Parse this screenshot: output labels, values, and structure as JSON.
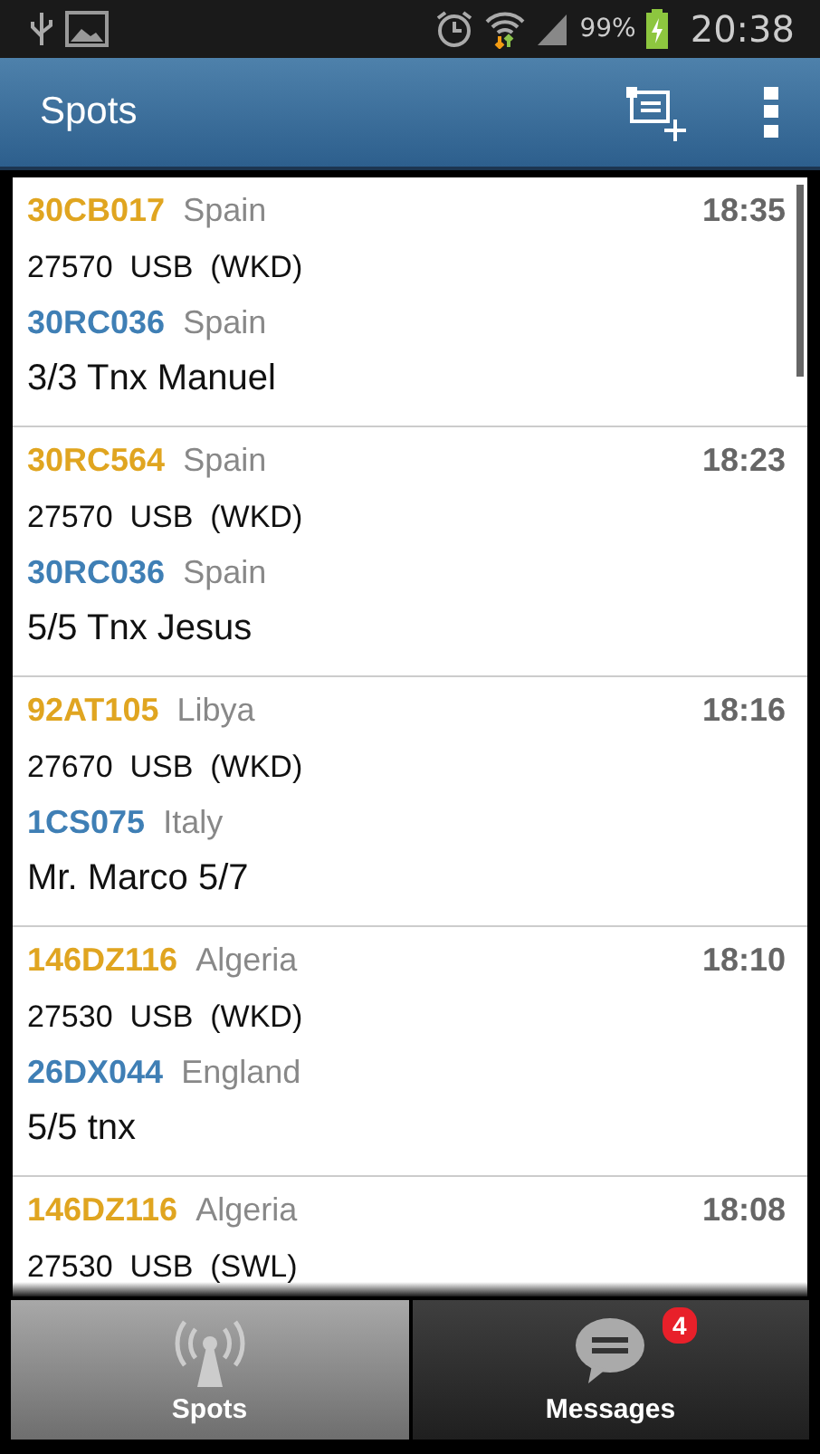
{
  "status_bar": {
    "battery": "99%",
    "time": "20:38"
  },
  "action_bar": {
    "title": "Spots"
  },
  "spots": [
    {
      "callsign": "30CB017",
      "country": "Spain",
      "time": "18:35",
      "frequency": "27570",
      "mode": "USB",
      "tag": "(WKD)",
      "spotter": "30RC036",
      "spotter_country": "Spain",
      "message": "3/3 Tnx Manuel"
    },
    {
      "callsign": "30RC564",
      "country": "Spain",
      "time": "18:23",
      "frequency": "27570",
      "mode": "USB",
      "tag": "(WKD)",
      "spotter": "30RC036",
      "spotter_country": "Spain",
      "message": "5/5 Tnx Jesus"
    },
    {
      "callsign": "92AT105",
      "country": "Libya",
      "time": "18:16",
      "frequency": "27670",
      "mode": "USB",
      "tag": "(WKD)",
      "spotter": "1CS075",
      "spotter_country": "Italy",
      "message": "Mr. Marco 5/7"
    },
    {
      "callsign": "146DZ116",
      "country": "Algeria",
      "time": "18:10",
      "frequency": "27530",
      "mode": "USB",
      "tag": "(WKD)",
      "spotter": "26DX044",
      "spotter_country": "England",
      "message": "5/5  tnx"
    },
    {
      "callsign": "146DZ116",
      "country": "Algeria",
      "time": "18:08",
      "frequency": "27530",
      "mode": "USB",
      "tag": "(SWL)"
    }
  ],
  "tabs": [
    {
      "label": "Spots",
      "kind": "antenna",
      "selected": true
    },
    {
      "label": "Messages",
      "kind": "chat",
      "selected": false,
      "badge": "4"
    }
  ]
}
